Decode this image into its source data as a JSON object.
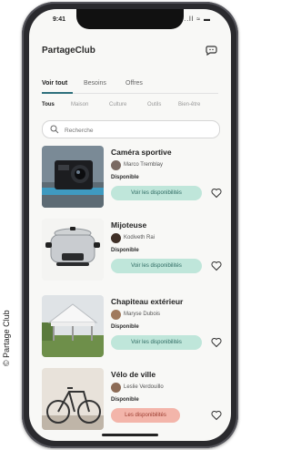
{
  "credit": "© Partage Club",
  "status": {
    "time": "9:41",
    "icons": "..ll ≈ ▬"
  },
  "app": {
    "title": "PartageClub"
  },
  "tabs": [
    "Voir tout",
    "Besoins",
    "Offres"
  ],
  "chips": [
    "Tous",
    "Maison",
    "Culture",
    "Outils",
    "Bien-être"
  ],
  "search": {
    "placeholder": "Recherche"
  },
  "items": [
    {
      "title": "Caméra sportive",
      "owner": "Marco Tremblay",
      "status": "Disponible",
      "button": "Voir les disponibilités",
      "button_style": "mint"
    },
    {
      "title": "Mijoteuse",
      "owner": "Kodiveth Rai",
      "status": "Disponible",
      "button": "Voir les disponibilités",
      "button_style": "mint"
    },
    {
      "title": "Chapiteau extérieur",
      "owner": "Maryse Dubois",
      "status": "Disponible",
      "button": "Voir les disponibilités",
      "button_style": "mint"
    },
    {
      "title": "Vélo de ville",
      "owner": "Leslie Verdouillo",
      "status": "Disponible",
      "button": "Les disponibilités",
      "button_style": "pink"
    }
  ],
  "colors": {
    "accent": "#2d6f7c",
    "mint": "#bfe6da",
    "pink": "#f3b5aa"
  }
}
